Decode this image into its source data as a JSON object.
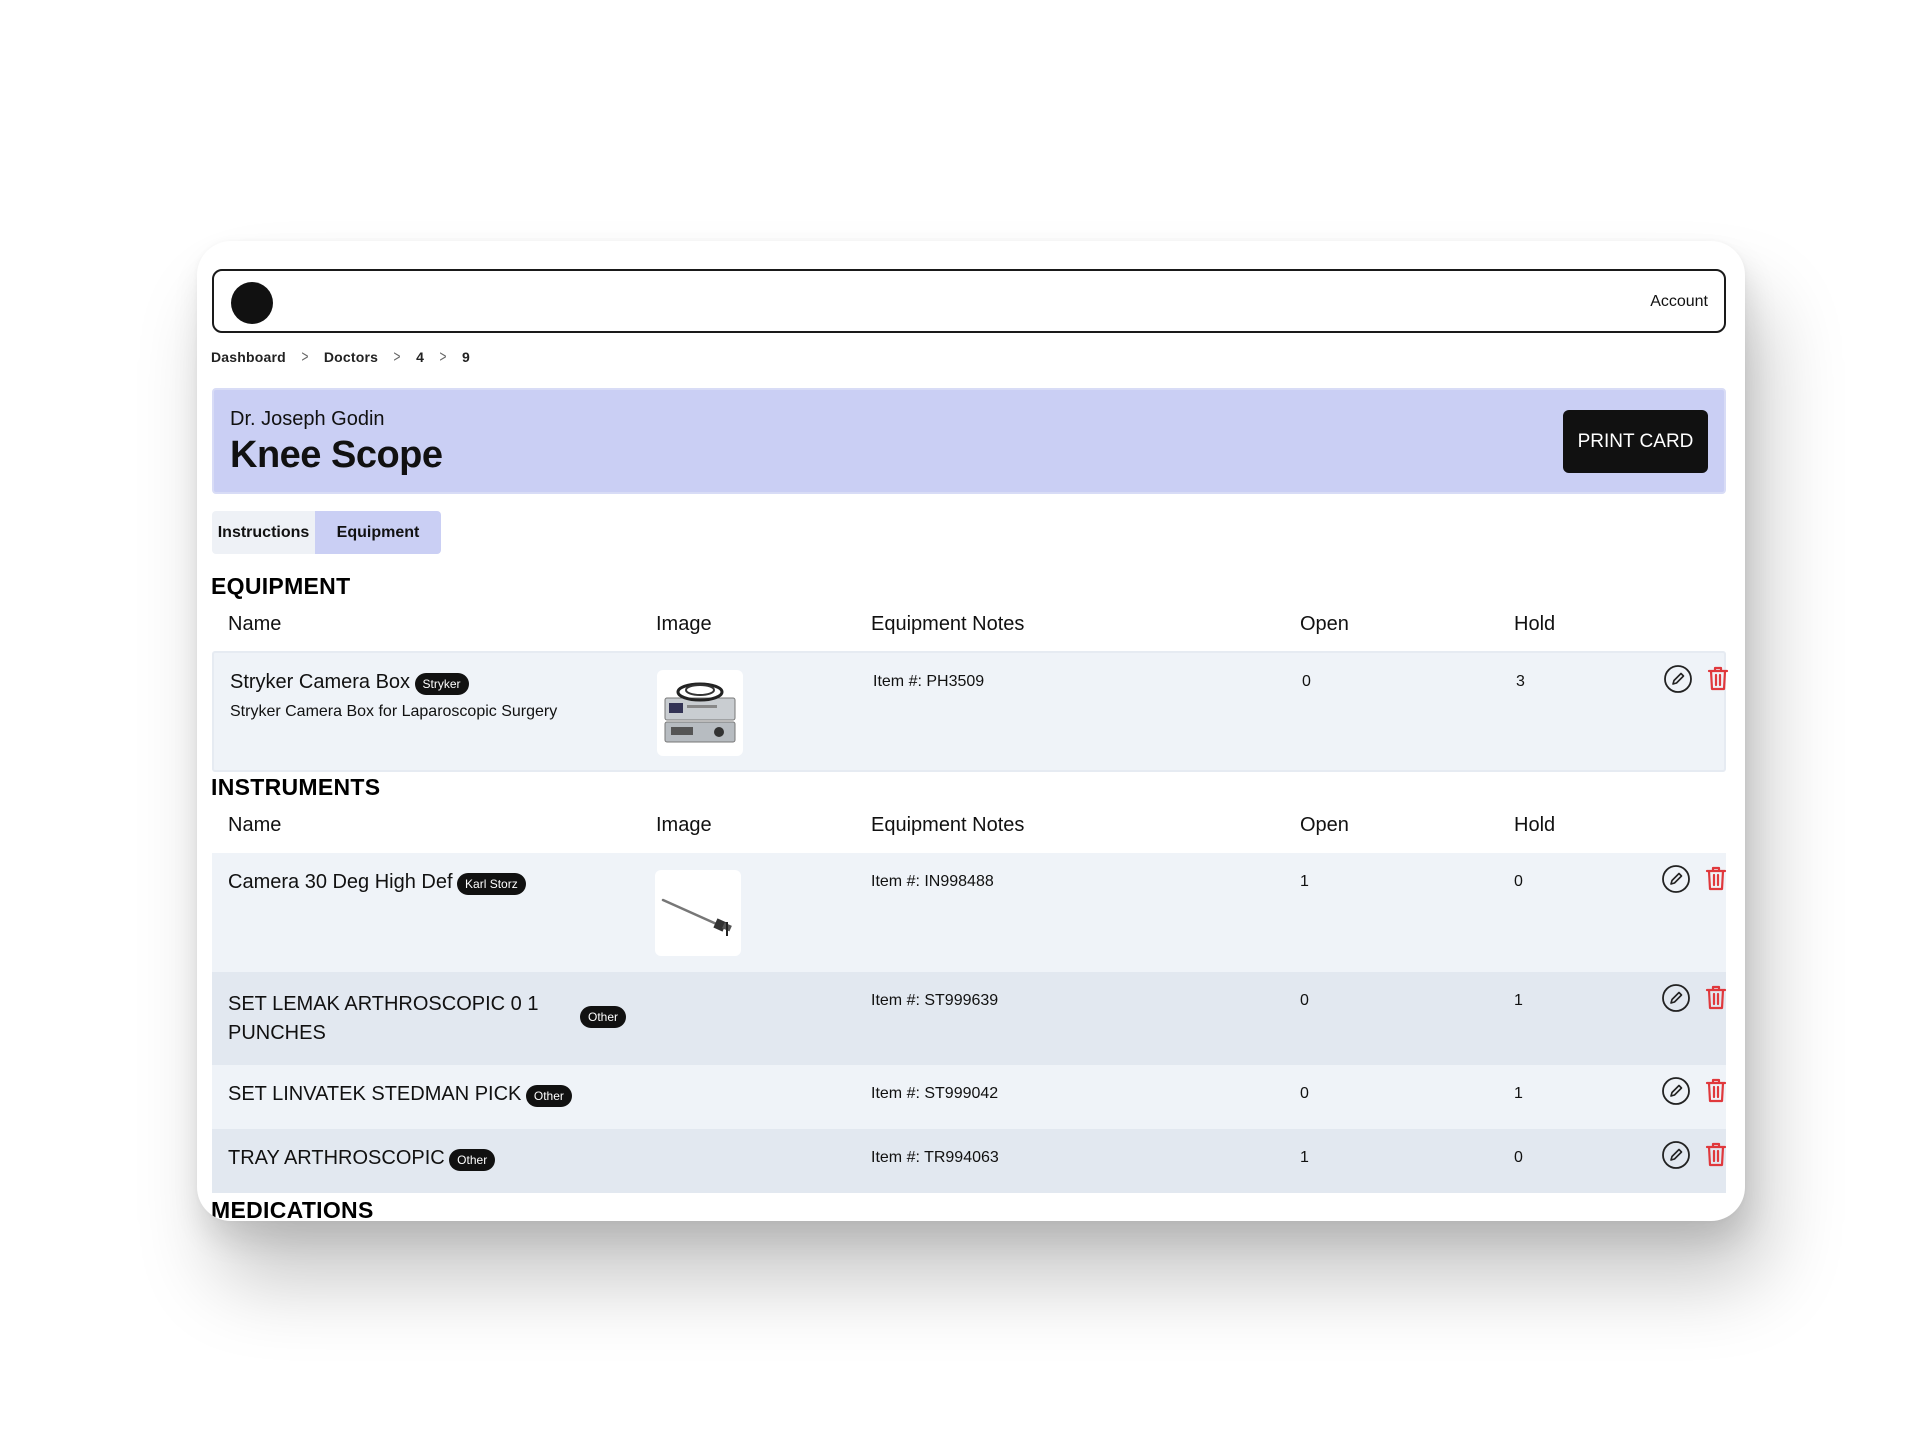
{
  "header": {
    "account_label": "Account"
  },
  "breadcrumb": [
    "Dashboard",
    "Doctors",
    "4",
    "9"
  ],
  "hero": {
    "doctor": "Dr. Joseph Godin",
    "title": "Knee Scope",
    "print_label": "PRINT CARD"
  },
  "tabs": [
    {
      "label": "Instructions",
      "active": false
    },
    {
      "label": "Equipment",
      "active": true
    }
  ],
  "columns": {
    "name": "Name",
    "image": "Image",
    "notes": "Equipment Notes",
    "open": "Open",
    "hold": "Hold"
  },
  "sections": {
    "equipment": {
      "title": "EQUIPMENT",
      "rows": [
        {
          "name": "Stryker Camera Box",
          "badge": "Stryker",
          "description": "Stryker Camera Box for Laparoscopic Surgery",
          "notes": "Item #: PH3509",
          "open": "0",
          "hold": "3"
        }
      ]
    },
    "instruments": {
      "title": "INSTRUMENTS",
      "rows": [
        {
          "name": "Camera 30 Deg High Def",
          "badge": "Karl Storz",
          "notes": "Item #: IN998488",
          "open": "1",
          "hold": "0"
        },
        {
          "name_line1": "SET LEMAK ARTHROSCOPIC 0 1",
          "name_line2": "PUNCHES",
          "badge": "Other",
          "notes": "Item #: ST999639",
          "open": "0",
          "hold": "1"
        },
        {
          "name": "SET LINVATEK STEDMAN PICK",
          "badge": "Other",
          "notes": "Item #: ST999042",
          "open": "0",
          "hold": "1"
        },
        {
          "name": "TRAY ARTHROSCOPIC",
          "badge": "Other",
          "notes": "Item #: TR994063",
          "open": "1",
          "hold": "0"
        }
      ]
    },
    "medications": {
      "title": "MEDICATIONS"
    }
  },
  "icons": {
    "edit": "pencil-circle-icon",
    "delete": "trash-icon",
    "delete_color": "#e0383c",
    "logo": "logo-circle"
  },
  "colors": {
    "accent": "#cacff4",
    "row_light": "#eff3f8",
    "row_dark": "#e2e8f0"
  }
}
